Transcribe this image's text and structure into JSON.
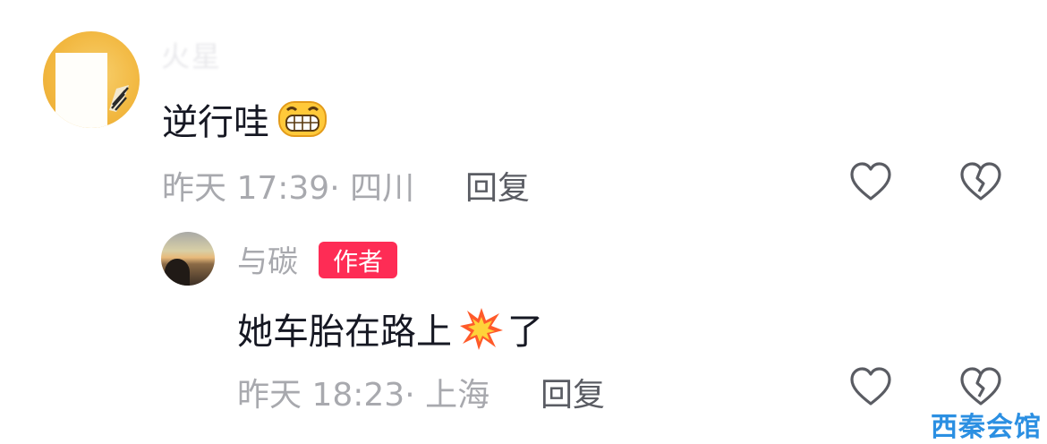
{
  "comments": [
    {
      "username": "火星",
      "text": "逆行哇",
      "emoji": "grinning-face-emoji",
      "time": "昨天 17:39",
      "location": "四川",
      "reply_label": "回复",
      "like_icon": "heart-outline-icon",
      "dislike_icon": "broken-heart-icon"
    },
    {
      "username": "与碳",
      "badge": "作者",
      "text_before": "她车胎在路上",
      "emoji": "collision-emoji",
      "text_after": "了",
      "time": "昨天 18:23",
      "location": "上海",
      "reply_label": "回复",
      "like_icon": "heart-outline-icon",
      "dislike_icon": "broken-heart-icon"
    }
  ],
  "watermark": "西秦会馆",
  "colors": {
    "badge": "#fe2c55",
    "meta": "#a8a9ae",
    "reply": "#5a5c63",
    "text": "#161823",
    "watermark": "#2b8fe2"
  }
}
